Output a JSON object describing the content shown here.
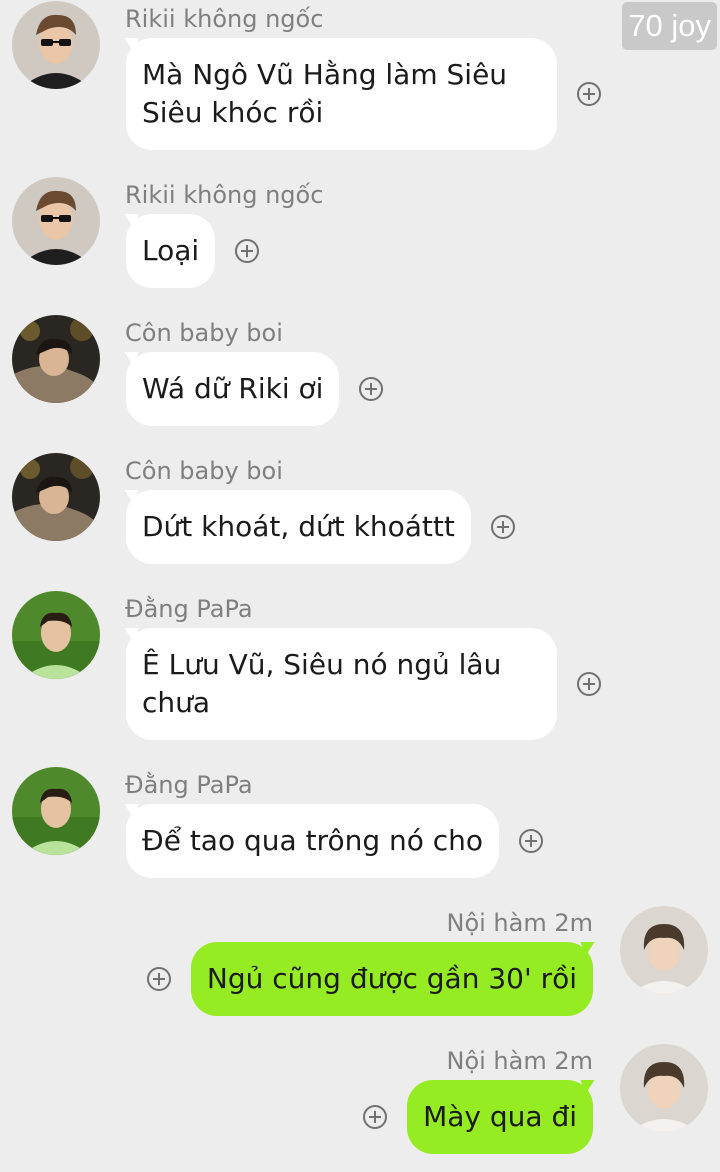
{
  "watermark": "70 joy",
  "messages": [
    {
      "sender": "Rikii không ngốc",
      "text": "Mà Ngô Vũ Hằng làm Siêu\nSiêu khóc rồi",
      "direction": "incoming",
      "avatar": "avatar-rikii"
    },
    {
      "sender": "Rikii không ngốc",
      "text": "Loại",
      "direction": "incoming",
      "avatar": "avatar-rikii"
    },
    {
      "sender": "Côn baby boi",
      "text": "Wá dữ Riki ơi",
      "direction": "incoming",
      "avatar": "avatar-con"
    },
    {
      "sender": "Côn baby boi",
      "text": "Dứt khoát, dứt khoáttt",
      "direction": "incoming",
      "avatar": "avatar-con"
    },
    {
      "sender": "Đằng PaPa",
      "text": "Ê Lưu Vũ, Siêu nó ngủ lâu\nchưa",
      "direction": "incoming",
      "avatar": "avatar-dang"
    },
    {
      "sender": "Đằng PaPa",
      "text": "Để tao qua trông nó cho",
      "direction": "incoming",
      "avatar": "avatar-dang"
    },
    {
      "sender": "Nội hàm 2m",
      "text": "Ngủ cũng được gần 30' rồi",
      "direction": "outgoing",
      "avatar": "avatar-noiham"
    },
    {
      "sender": "Nội hàm 2m",
      "text": "Mày qua đi",
      "direction": "outgoing",
      "avatar": "avatar-noiham"
    }
  ],
  "colors": {
    "background": "#ededed",
    "incoming_bubble": "#ffffff",
    "outgoing_bubble": "#95ec22",
    "sender_name": "#7f7f7f"
  }
}
